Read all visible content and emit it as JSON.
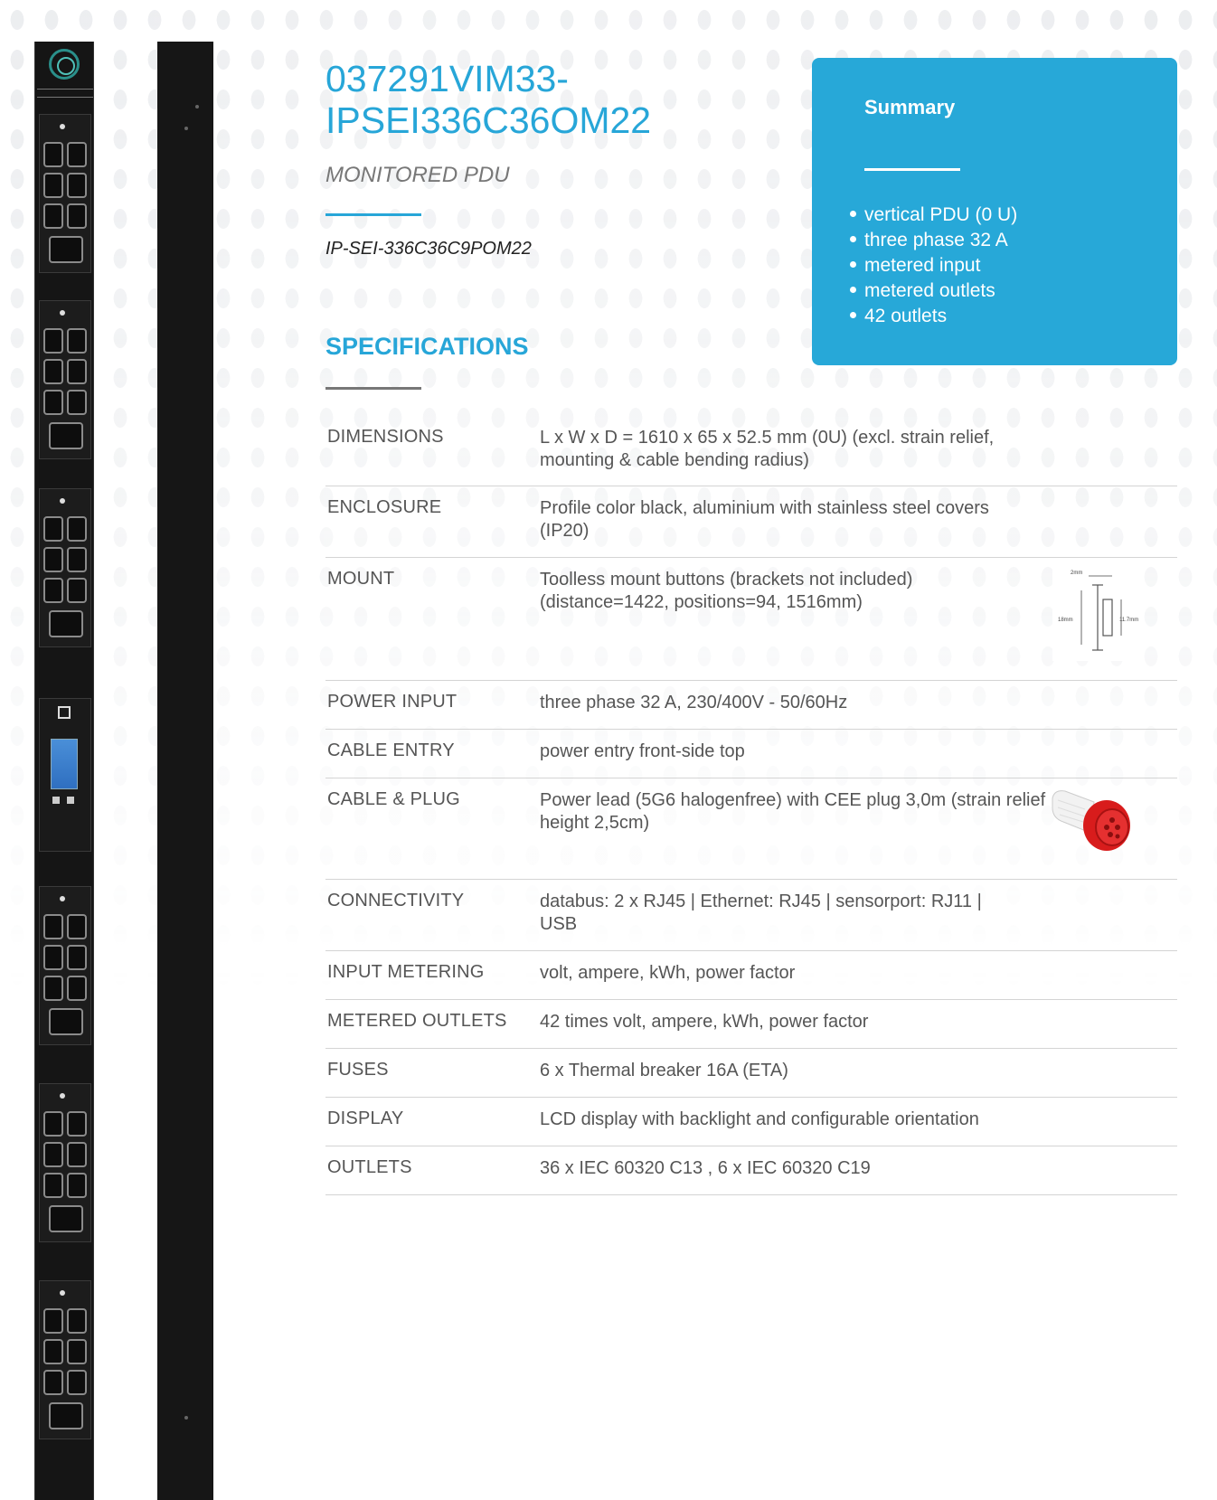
{
  "product": {
    "title": "037291VIM33-IPSEI336C36OM22",
    "subtitle": "MONITORED PDU",
    "part_number": "IP-SEI-336C36C9POM22",
    "accent_color": "#27a6d8"
  },
  "summary": {
    "heading": "Summary",
    "items": [
      "vertical PDU (0 U)",
      "three phase 32 A",
      "metered input",
      "metered outlets",
      "42 outlets"
    ],
    "background_color": "#27a8d8"
  },
  "specifications": {
    "heading": "SPECIFICATIONS",
    "rows": [
      {
        "label": "DIMENSIONS",
        "value": "L x W x D = 1610 x 65 x 52.5 mm (0U) (excl. strain relief, mounting & cable bending radius)"
      },
      {
        "label": "ENCLOSURE",
        "value": "Profile color black, aluminium with stainless steel covers (IP20)"
      },
      {
        "label": "MOUNT",
        "value": "Toolless mount buttons (brackets not included) (distance=1422, positions=94, 1516mm)",
        "image": "mount-bracket-diagram",
        "image_labels": [
          "2mm",
          "18mm",
          "11.7mm"
        ]
      },
      {
        "label": "POWER INPUT",
        "value": "three phase 32 A, 230/400V - 50/60Hz"
      },
      {
        "label": "CABLE ENTRY",
        "value": "power entry front-side top"
      },
      {
        "label": "CABLE & PLUG",
        "value": "Power lead (5G6 halogenfree) with CEE plug 3,0m (strain relief height 2,5cm)",
        "image": "cee-plug-photo"
      },
      {
        "label": "CONNECTIVITY",
        "value": "databus: 2 x RJ45 | Ethernet: RJ45 | sensorport: RJ11 | USB"
      },
      {
        "label": "INPUT METERING",
        "value": "volt, ampere, kWh, power factor"
      },
      {
        "label": "METERED OUTLETS",
        "value": "42 times volt, ampere, kWh, power factor"
      },
      {
        "label": "FUSES",
        "value": "6 x Thermal breaker 16A (ETA)"
      },
      {
        "label": "DISPLAY",
        "value": "LCD display with backlight and configurable orientation"
      },
      {
        "label": "OUTLETS",
        "value": "36 x IEC 60320 C13 , 6 x IEC 60320 C19"
      }
    ]
  }
}
